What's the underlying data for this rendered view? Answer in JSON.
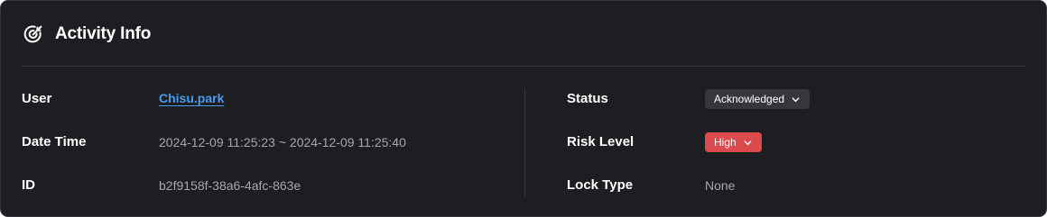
{
  "panel": {
    "title": "Activity Info",
    "title_icon": "target-icon"
  },
  "left": {
    "user_label": "User",
    "user_value": "Chisu.park",
    "datetime_label": "Date Time",
    "datetime_value": "2024-12-09 11:25:23 ~ 2024-12-09 11:25:40",
    "id_label": "ID",
    "id_value": "b2f9158f-38a6-4afc-863e"
  },
  "right": {
    "status_label": "Status",
    "status_value": "Acknowledged",
    "risk_label": "Risk Level",
    "risk_value": "High",
    "lock_label": "Lock Type",
    "lock_value": "None"
  },
  "colors": {
    "background": "#1d1e22",
    "link": "#4a9cf0",
    "risk_high": "#dc4a4e",
    "status_chip": "#35373d"
  }
}
